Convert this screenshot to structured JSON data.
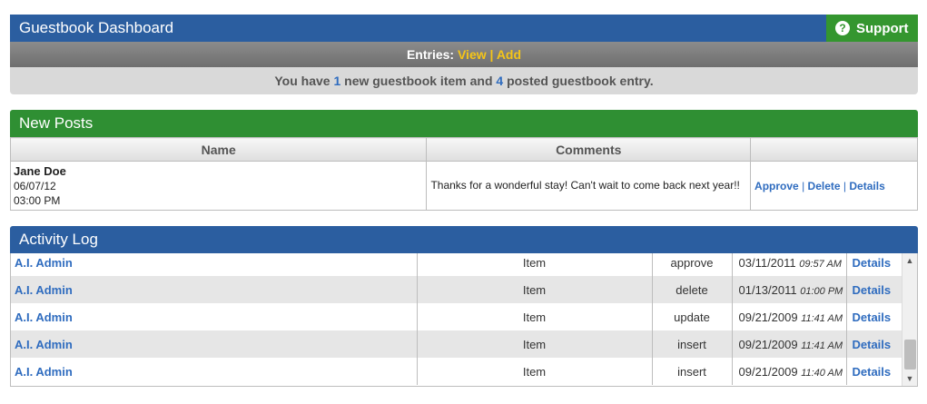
{
  "dashboard": {
    "title": "Guestbook Dashboard",
    "support_label": "Support",
    "support_icon": "help-icon",
    "accent_blue": "#2b5ea0",
    "accent_green": "#34962f"
  },
  "entries": {
    "label": "Entries:",
    "view": "View",
    "separator": "|",
    "add": "Add"
  },
  "summary": {
    "prefix": "You have",
    "new_count": "1",
    "middle": "new guestbook item and",
    "posted_count": "4",
    "suffix": "posted guestbook entry."
  },
  "new_posts": {
    "title": "New Posts",
    "columns": [
      "Name",
      "Comments",
      ""
    ],
    "rows": [
      {
        "name": "Jane Doe",
        "date": "06/07/12",
        "time": "03:00 PM",
        "comment": "Thanks for a wonderful stay! Can't wait to come back next year!!",
        "actions": [
          "Approve",
          "Delete",
          "Details"
        ]
      }
    ]
  },
  "activity_log": {
    "title": "Activity Log",
    "rows": [
      {
        "user": "A.I. Admin",
        "type": "Item",
        "action": "approve",
        "date": "03/11/2011",
        "time": "09:57 AM",
        "details": "Details"
      },
      {
        "user": "A.I. Admin",
        "type": "Item",
        "action": "delete",
        "date": "01/13/2011",
        "time": "01:00 PM",
        "details": "Details"
      },
      {
        "user": "A.I. Admin",
        "type": "Item",
        "action": "update",
        "date": "09/21/2009",
        "time": "11:41 AM",
        "details": "Details"
      },
      {
        "user": "A.I. Admin",
        "type": "Item",
        "action": "insert",
        "date": "09/21/2009",
        "time": "11:41 AM",
        "details": "Details"
      },
      {
        "user": "A.I. Admin",
        "type": "Item",
        "action": "insert",
        "date": "09/21/2009",
        "time": "11:40 AM",
        "details": "Details"
      }
    ]
  }
}
